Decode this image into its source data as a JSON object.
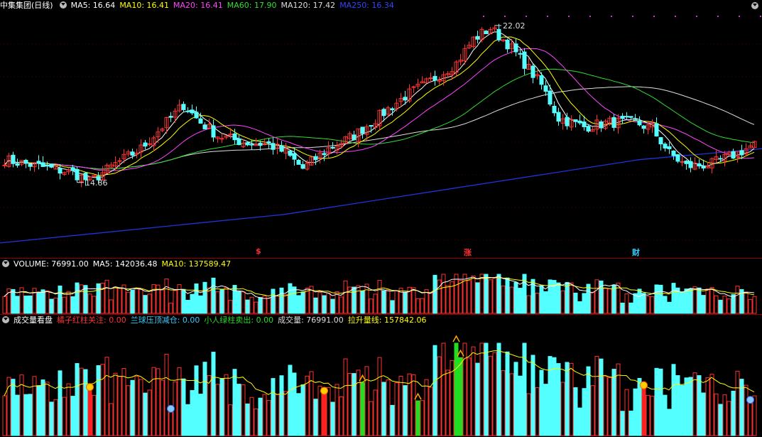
{
  "main": {
    "stock_name": "中集集团(日线)",
    "ma": [
      {
        "label": "MA5: 16.64",
        "color": "#ffffff"
      },
      {
        "label": "MA10: 16.41",
        "color": "#ffff00"
      },
      {
        "label": "MA20: 16.41",
        "color": "#ff44ff"
      },
      {
        "label": "MA60: 17.90",
        "color": "#33dd33"
      },
      {
        "label": "MA120: 17.42",
        "color": "#dddddd"
      },
      {
        "label": "MA250: 16.34",
        "color": "#3344ff"
      }
    ],
    "high_label": "22.02",
    "low_label": "14.86",
    "markers": [
      {
        "text": "$",
        "color": "#ff3030"
      },
      {
        "text": "涨",
        "color": "#ff3030"
      },
      {
        "text": "财",
        "color": "#33ccff"
      }
    ]
  },
  "volume": {
    "name": "VOLUME: 76991.00",
    "ma5": "MA5: 142036.48",
    "ma10": "MA10: 137589.47"
  },
  "indicator": {
    "name": "成交量看盘",
    "items": [
      {
        "label": "橘子红柱关注: 0.00",
        "color": "#ff3030"
      },
      {
        "label": "兰球压顶减仓: 0.00",
        "color": "#33ccff"
      },
      {
        "label": "小人绿柱卖出: 0.00",
        "color": "#22dd22"
      },
      {
        "label": "成交量: 76991.00",
        "color": "#dddddd"
      },
      {
        "label": "拉升量线: 157842.06",
        "color": "#ffff00"
      }
    ]
  },
  "colors": {
    "up": "#ff3030",
    "down": "#54ffff",
    "ma250": "#2233dd",
    "background": "#000000"
  },
  "chart_data": {
    "type": "candlestick",
    "title": "中集集团(日线)",
    "price_range": [
      12.0,
      22.6
    ],
    "high": 22.02,
    "low": 14.86,
    "trend": [
      [
        0,
        15.9
      ],
      [
        8,
        15.6
      ],
      [
        16,
        15.3
      ],
      [
        20,
        14.9
      ],
      [
        26,
        15.7
      ],
      [
        32,
        16.4
      ],
      [
        38,
        17.6
      ],
      [
        42,
        18.4
      ],
      [
        46,
        17.6
      ],
      [
        50,
        17.0
      ],
      [
        56,
        16.7
      ],
      [
        62,
        16.6
      ],
      [
        66,
        16.2
      ],
      [
        70,
        15.5
      ],
      [
        76,
        16.4
      ],
      [
        82,
        17.0
      ],
      [
        88,
        17.9
      ],
      [
        94,
        18.8
      ],
      [
        100,
        19.5
      ],
      [
        106,
        20.3
      ],
      [
        110,
        21.4
      ],
      [
        114,
        21.9
      ],
      [
        118,
        21.2
      ],
      [
        122,
        20.3
      ],
      [
        126,
        19.3
      ],
      [
        130,
        17.8
      ],
      [
        136,
        17.4
      ],
      [
        142,
        17.6
      ],
      [
        148,
        17.6
      ],
      [
        152,
        17.3
      ],
      [
        156,
        16.2
      ],
      [
        160,
        15.6
      ],
      [
        166,
        15.7
      ],
      [
        172,
        16.2
      ],
      [
        176,
        16.6
      ]
    ],
    "volume_last": 76991.0,
    "volume_ma5": 142036.48,
    "volume_ma10": 137589.47,
    "ma_last": {
      "MA5": 16.64,
      "MA10": 16.41,
      "MA20": 16.41,
      "MA60": 17.9,
      "MA120": 17.42,
      "MA250": 16.34
    }
  }
}
